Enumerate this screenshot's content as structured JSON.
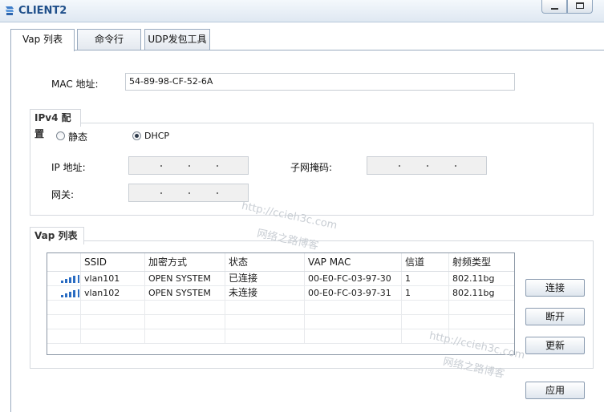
{
  "window": {
    "title": "CLIENT2"
  },
  "tabs": [
    {
      "label": "Vap 列表"
    },
    {
      "label": "命令行"
    },
    {
      "label": "UDP发包工具"
    }
  ],
  "mac": {
    "label": "MAC 地址:",
    "value": "54-89-98-CF-52-6A"
  },
  "ipv4": {
    "group_label": "IPv4 配置",
    "static_label": "静态",
    "dhcp_label": "DHCP",
    "selected": "DHCP",
    "ip_label": "IP 地址:",
    "mask_label": "子网掩码:",
    "gateway_label": "网关:"
  },
  "vap": {
    "group_label": "Vap 列表",
    "columns": [
      "SSID",
      "加密方式",
      "状态",
      "VAP MAC",
      "信道",
      "射频类型"
    ],
    "rows": [
      {
        "signal_bars": 4,
        "ssid": "vlan101",
        "encryption": "OPEN SYSTEM",
        "status": "已连接",
        "vap_mac": "00-E0-FC-03-97-30",
        "channel": "1",
        "radio": "802.11bg"
      },
      {
        "signal_bars": 4,
        "ssid": "vlan102",
        "encryption": "OPEN SYSTEM",
        "status": "未连接",
        "vap_mac": "00-E0-FC-03-97-31",
        "channel": "1",
        "radio": "802.11bg"
      }
    ]
  },
  "buttons": {
    "connect": "连接",
    "disconnect": "断开",
    "refresh": "更新",
    "apply": "应用"
  },
  "watermark": {
    "url": "http://ccieh3c.com",
    "text": "网络之路博客"
  },
  "icons": {
    "app": "network-client-icon",
    "minimize": "minimize-icon",
    "maximize": "maximize-icon"
  },
  "colors": {
    "title": "#1f4f8a",
    "signal": "#2a6cc2"
  }
}
